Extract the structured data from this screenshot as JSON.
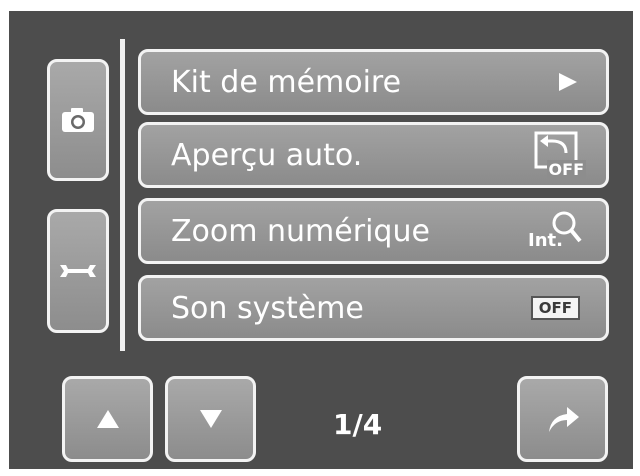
{
  "menu": {
    "items": [
      {
        "label": "Kit de mémoire",
        "icon": "play-arrow-icon"
      },
      {
        "label": "Aperçu auto.",
        "icon": "auto-review-off-icon",
        "badge": "OFF"
      },
      {
        "label": "Zoom numérique",
        "icon": "digital-zoom-icon",
        "badge": "Int."
      },
      {
        "label": "Son système",
        "icon": "sound-off-icon",
        "badge": "OFF"
      }
    ]
  },
  "tabs": [
    {
      "name": "camera",
      "icon": "camera-icon"
    },
    {
      "name": "setup",
      "icon": "wrench-icon"
    }
  ],
  "navigation": {
    "page": "1/4",
    "up_icon": "triangle-up-icon",
    "down_icon": "triangle-down-icon",
    "next_icon": "curved-arrow-icon"
  },
  "colors": {
    "background": "#4d4d4d",
    "button_fill": "#999999",
    "button_border": "#f3f3f3",
    "text": "#ffffff"
  }
}
